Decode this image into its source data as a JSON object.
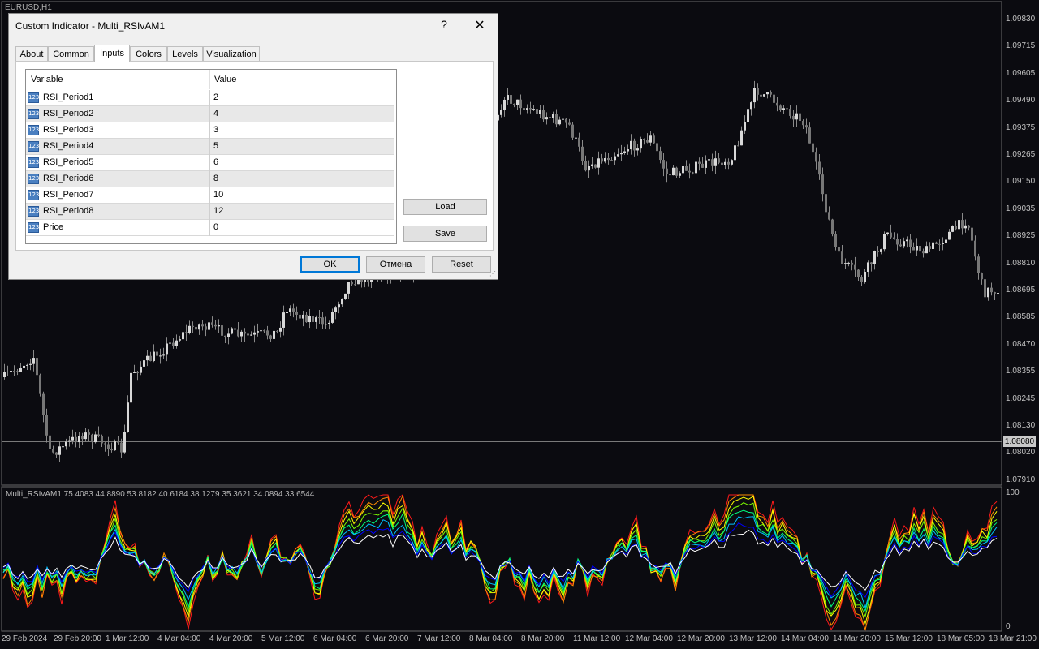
{
  "chart": {
    "symbol_title": "EURUSD,H1",
    "current_price": "1.08080",
    "price_labels": [
      "1.09830",
      "1.09715",
      "1.09605",
      "1.09490",
      "1.09375",
      "1.09265",
      "1.09150",
      "1.09035",
      "1.08925",
      "1.08810",
      "1.08695",
      "1.08585",
      "1.08470",
      "1.08355",
      "1.08245",
      "1.08130",
      "1.08020",
      "1.07910"
    ],
    "indicator_label": "Multi_RSIvAM1 75.4083 44.8890 53.8182 40.6184 38.1279 35.3621 34.0894 33.6544",
    "indicator_scale": {
      "top": "100",
      "bottom": "0"
    },
    "time_labels": [
      "29 Feb 2024",
      "29 Feb 20:00",
      "1 Mar 12:00",
      "4 Mar 04:00",
      "4 Mar 20:00",
      "5 Mar 12:00",
      "6 Mar 04:00",
      "6 Mar 20:00",
      "7 Mar 12:00",
      "8 Mar 04:00",
      "8 Mar 20:00",
      "11 Mar 12:00",
      "12 Mar 04:00",
      "12 Mar 20:00",
      "13 Mar 12:00",
      "14 Mar 04:00",
      "14 Mar 20:00",
      "15 Mar 12:00",
      "18 Mar 05:00",
      "18 Mar 21:00"
    ],
    "colors": {
      "background": "#0b0b10",
      "candles": "#9a9a9a",
      "series": [
        "#ff1a1a",
        "#ff8c00",
        "#ffff00",
        "#7cfc00",
        "#00ff7f",
        "#00bfff",
        "#0000ff",
        "#ffffff"
      ]
    }
  },
  "dialog": {
    "title": "Custom Indicator - Multi_RSIvAM1",
    "help_label": "?",
    "close_label": "✕",
    "tabs": [
      "About",
      "Common",
      "Inputs",
      "Colors",
      "Levels",
      "Visualization"
    ],
    "active_tab": "Inputs",
    "grid": {
      "headers": {
        "variable": "Variable",
        "value": "Value"
      },
      "rows": [
        {
          "name": "RSI_Period1",
          "value": "2",
          "icon": "int-icon"
        },
        {
          "name": "RSI_Period2",
          "value": "4",
          "icon": "int-icon"
        },
        {
          "name": "RSI_Period3",
          "value": "3",
          "icon": "int-icon"
        },
        {
          "name": "RSI_Period4",
          "value": "5",
          "icon": "int-icon"
        },
        {
          "name": "RSI_Period5",
          "value": "6",
          "icon": "int-icon"
        },
        {
          "name": "RSI_Period6",
          "value": "8",
          "icon": "int-icon"
        },
        {
          "name": "RSI_Period7",
          "value": "10",
          "icon": "int-icon"
        },
        {
          "name": "RSI_Period8",
          "value": "12",
          "icon": "int-icon"
        },
        {
          "name": "Price",
          "value": "0",
          "icon": "int-icon"
        }
      ]
    },
    "icon_glyph": "123",
    "buttons": {
      "load": "Load",
      "save": "Save",
      "ok": "OK",
      "cancel": "Отмена",
      "reset": "Reset"
    }
  }
}
